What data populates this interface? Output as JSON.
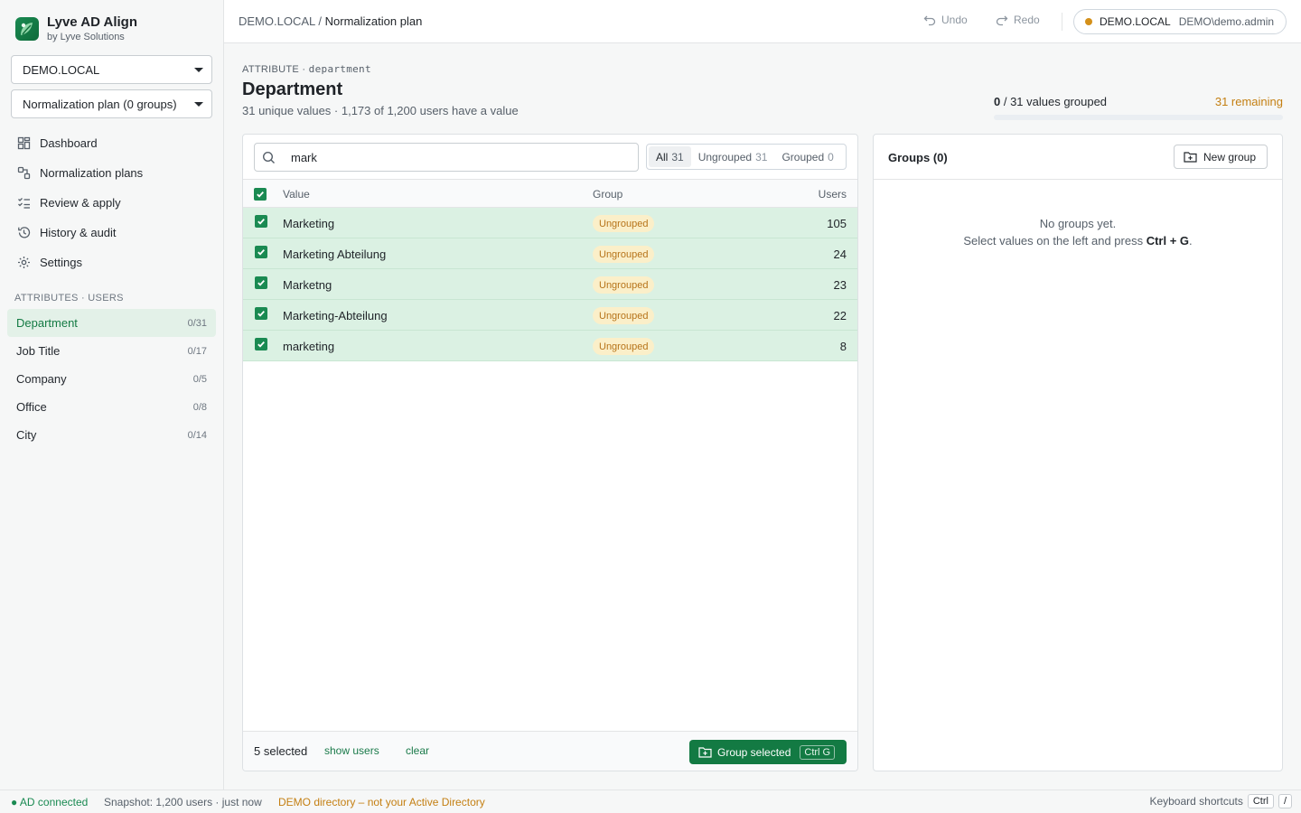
{
  "app": {
    "title": "Lyve AD Align",
    "subtitle": "by Lyve Solutions"
  },
  "sidebar": {
    "domain_select": "DEMO.LOCAL",
    "plan_select": "Normalization plan (0 groups)",
    "nav": [
      {
        "label": "Dashboard",
        "icon": "dashboard-icon"
      },
      {
        "label": "Normalization plans",
        "icon": "plans-icon"
      },
      {
        "label": "Review & apply",
        "icon": "checklist-icon"
      },
      {
        "label": "History & audit",
        "icon": "history-icon"
      },
      {
        "label": "Settings",
        "icon": "gear-icon"
      }
    ],
    "attributes_label": "ATTRIBUTES · USERS",
    "attributes": [
      {
        "label": "Department",
        "count": "0/31",
        "active": true
      },
      {
        "label": "Job Title",
        "count": "0/17"
      },
      {
        "label": "Company",
        "count": "0/5"
      },
      {
        "label": "Office",
        "count": "0/8"
      },
      {
        "label": "City",
        "count": "0/14"
      }
    ]
  },
  "topbar": {
    "crumb_root": "DEMO.LOCAL",
    "crumb_sep": "/",
    "crumb_current": "Normalization plan",
    "undo": "Undo",
    "redo": "Redo",
    "env_name": "DEMO.LOCAL",
    "env_user": "DEMO\\demo.admin",
    "env_color": "#d4901a"
  },
  "header": {
    "kicker": "ATTRIBUTE · ",
    "kicker_attr": "department",
    "title": "Department",
    "subtitle": "31 unique values · 1,173 of 1,200 users have a value",
    "progress_done": "0",
    "progress_rest": " / 31 values grouped",
    "progress_fraction": 0,
    "remaining": "31 remaining"
  },
  "values": {
    "search_value": "mark",
    "tabs": [
      {
        "label": "All",
        "count": "31",
        "active": true
      },
      {
        "label": "Ungrouped",
        "count": "31"
      },
      {
        "label": "Grouped",
        "count": "0"
      }
    ],
    "columns": {
      "value": "Value",
      "group": "Group",
      "users": "Users"
    },
    "rows": [
      {
        "value": "Marketing",
        "group": "Ungrouped",
        "users": "105",
        "checked": true
      },
      {
        "value": "Marketing Abteilung",
        "group": "Ungrouped",
        "users": "24",
        "checked": true
      },
      {
        "value": "Marketng",
        "group": "Ungrouped",
        "users": "23",
        "checked": true
      },
      {
        "value": "Marketing-Abteilung",
        "group": "Ungrouped",
        "users": "22",
        "checked": true
      },
      {
        "value": "marketing",
        "group": "Ungrouped",
        "users": "8",
        "checked": true
      }
    ],
    "footer": {
      "selected": "5 selected",
      "show_users": "show users",
      "clear": "clear",
      "group_button": "Group selected",
      "group_shortcut": "Ctrl G"
    }
  },
  "groups": {
    "title": "Groups (0)",
    "new_group": "New group",
    "empty_line1": "No groups yet.",
    "empty_line2_pre": "Select values on the left and press ",
    "empty_line2_key": "Ctrl + G",
    "empty_line2_post": "."
  },
  "status": {
    "connected": "● AD connected",
    "snapshot": "Snapshot: 1,200 users · just now",
    "demo": "DEMO directory – not your Active Directory",
    "shortcuts": "Keyboard shortcuts",
    "key1": "Ctrl",
    "key2": "/"
  },
  "colors": {
    "accent": "#137a43",
    "selected_row": "#dbf1e3",
    "badge_bg": "#fbefc9",
    "badge_text": "#b7741a",
    "remaining": "#c47f12"
  }
}
